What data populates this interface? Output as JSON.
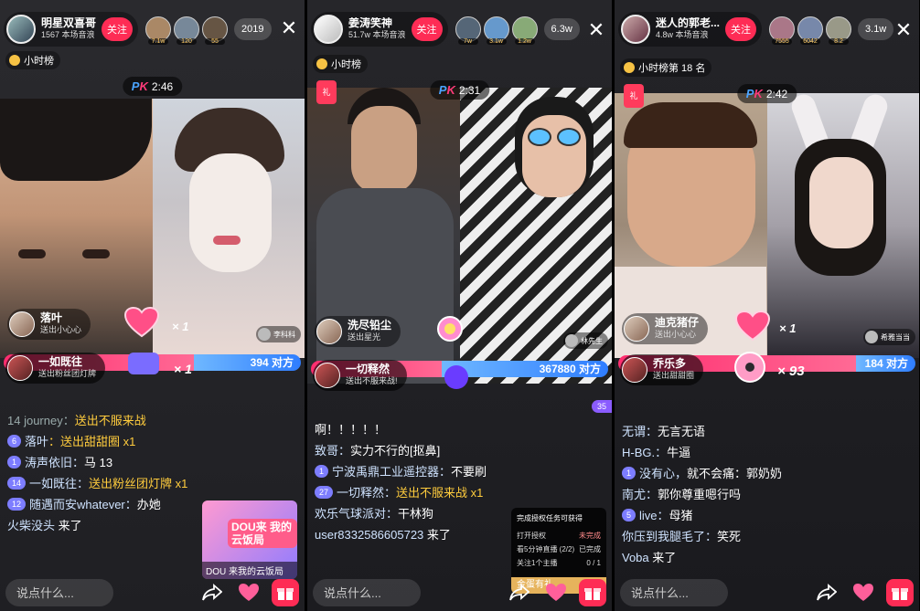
{
  "panels": [
    {
      "host": {
        "name": "明星双喜哥",
        "sub": "1567 本场音浪",
        "follow": "关注"
      },
      "viewers": [
        "7.1w",
        "120",
        "55"
      ],
      "count": "2019",
      "rank": "小时榜",
      "pk_timer": "2:46",
      "sender": {
        "name": "落叶",
        "gift": "送出小心心"
      },
      "combo": "× 1",
      "guest": "李科科",
      "bar_sender": {
        "name": "一如既往",
        "gift": "送出粉丝团灯牌"
      },
      "bar_combo": "× 1",
      "opponent_score": "394 对方",
      "chat": [
        {
          "badge": "",
          "name": "14 journey：",
          "msg": "送出不服来战",
          "gold": true
        },
        {
          "badge": "6",
          "name": "落叶",
          "msg": "：送出甜甜圈 x1",
          "gold": true
        },
        {
          "badge": "1",
          "name": "涛声依旧：",
          "msg": "马 13",
          "gold": false
        },
        {
          "badge": "14",
          "name": "一如既往：",
          "msg": "送出粉丝团灯牌 x1",
          "gold": true
        },
        {
          "badge": "12",
          "name": "随遇而安whatever：",
          "msg": "办她",
          "gold": false
        },
        {
          "badge": "",
          "name": "火柴没头",
          "msg": " 来了",
          "gold": false
        }
      ],
      "promo": {
        "title": "DOU来 我的云饭局",
        "caption": "DOU 来我的云饭局"
      },
      "input_placeholder": "说点什么..."
    },
    {
      "host": {
        "name": "姜涛笑神",
        "sub": "51.7w 本场音浪",
        "follow": "关注"
      },
      "viewers": [
        "7w",
        "3.1w",
        "1.2w"
      ],
      "count": "6.3w",
      "rank": "小时榜",
      "pk_timer": "2:31",
      "sender": {
        "name": "洗尽铅尘",
        "gift": "送出星光"
      },
      "guest": "林先生",
      "bar_sender": {
        "name": "一切释然",
        "gift": "送出不服来战!"
      },
      "opponent_score": "367880 对方",
      "side_pill": "35",
      "chat": [
        {
          "badge": "",
          "name": "",
          "msg": "啊！！！！！",
          "gold": false
        },
        {
          "badge": "",
          "name": "致哥：",
          "msg": "实力不行的[抠鼻]",
          "gold": false
        },
        {
          "badge": "1",
          "name": "宁波禹鼎工业遥控器：",
          "msg": "不要刷",
          "gold": false
        },
        {
          "badge": "27",
          "name": "一切释然：",
          "msg": "送出不服来战 x1",
          "gold": true
        },
        {
          "badge": "",
          "name": "欢乐气球派对：",
          "msg": "干林狗",
          "gold": false
        },
        {
          "badge": "",
          "name": "user8332586605723",
          "msg": " 来了",
          "gold": false
        }
      ],
      "task": {
        "title": "完成授权任务可获得",
        "rows": [
          [
            "打开授权",
            "未完成"
          ],
          [
            "看5分钟直播 (2/2)",
            "已完成"
          ],
          [
            "关注1个主播",
            "0 / 1"
          ]
        ],
        "button": "金蛋有礼"
      },
      "input_placeholder": "说点什么..."
    },
    {
      "host": {
        "name": "迷人的郭老...",
        "sub": "4.8w 本场音浪",
        "follow": "关注"
      },
      "viewers": [
        "7555",
        "6042",
        "8.2"
      ],
      "count": "3.1w",
      "rank": "小时榜第 18 名",
      "pk_timer": "2:42",
      "sender": {
        "name": "迪克猪仔",
        "gift": "送出小心心"
      },
      "combo": "× 1",
      "guest": "希雅当当",
      "bar_sender": {
        "name": "乔乐多",
        "gift": "送出甜甜圈"
      },
      "bar_combo": "× 93",
      "opponent_score": "184 对方",
      "chat": [
        {
          "badge": "",
          "name": "无谓：",
          "msg": "无言无语",
          "gold": false
        },
        {
          "badge": "",
          "name": "H-BG.：",
          "msg": "牛逼",
          "gold": false
        },
        {
          "badge": "1",
          "name": "没有心，",
          "msg": "就不会痛：郭奶奶",
          "gold": false
        },
        {
          "badge": "",
          "name": "南尤：",
          "msg": "郭你尊重嗯行吗",
          "gold": false
        },
        {
          "badge": "5",
          "name": "live：",
          "msg": "母猪",
          "gold": false
        },
        {
          "badge": "",
          "name": "你压到我腿毛了：",
          "msg": "笑死",
          "gold": false
        },
        {
          "badge": "",
          "name": "Voba",
          "msg": " 来了",
          "gold": false
        }
      ],
      "input_placeholder": "说点什么..."
    }
  ],
  "colors": {
    "accent": "#fe2c55",
    "pk_red": "#ff2d6f",
    "pk_blue": "#2f7dff",
    "gold": "#ffcc3d"
  }
}
